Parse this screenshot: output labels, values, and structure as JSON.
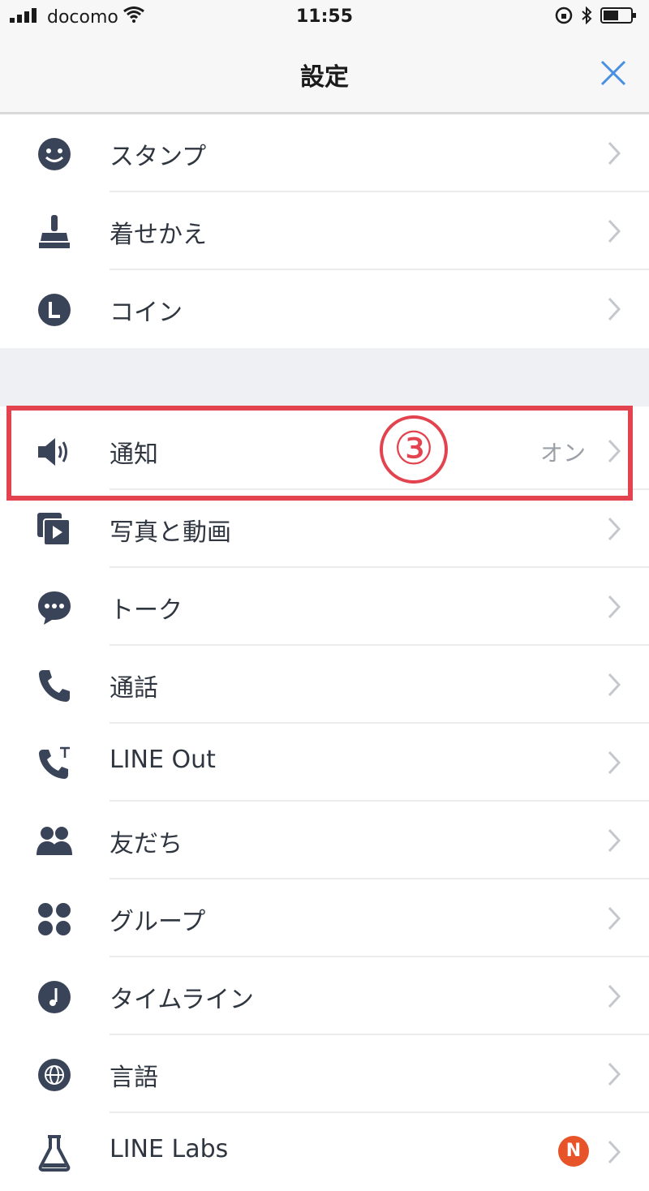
{
  "status_bar": {
    "carrier": "docomo",
    "time": "11:55"
  },
  "header": {
    "title": "設定",
    "close_icon": "close-icon"
  },
  "section1": [
    {
      "label": "スタンプ",
      "icon": "sticker-icon"
    },
    {
      "label": "着せかえ",
      "icon": "theme-icon"
    },
    {
      "label": "コイン",
      "icon": "coin-icon"
    }
  ],
  "notification": {
    "label": "通知",
    "value": "オン",
    "icon": "speaker-icon"
  },
  "annotation": {
    "marker": "③"
  },
  "section2": [
    {
      "label": "写真と動画",
      "icon": "photo-video-icon"
    },
    {
      "label": "トーク",
      "icon": "chat-icon"
    },
    {
      "label": "通話",
      "icon": "phone-icon"
    },
    {
      "label": "LINE Out",
      "icon": "line-out-icon"
    },
    {
      "label": "友だち",
      "icon": "friends-icon"
    },
    {
      "label": "グループ",
      "icon": "group-icon"
    },
    {
      "label": "タイムライン",
      "icon": "timeline-icon"
    },
    {
      "label": "言語",
      "icon": "language-icon"
    },
    {
      "label": "LINE Labs",
      "icon": "labs-icon",
      "badge": "N"
    }
  ],
  "colors": {
    "icon": "#3a4459",
    "accent_blue": "#4a90e2",
    "highlight_red": "#e2434f",
    "badge_orange": "#e8542a"
  }
}
